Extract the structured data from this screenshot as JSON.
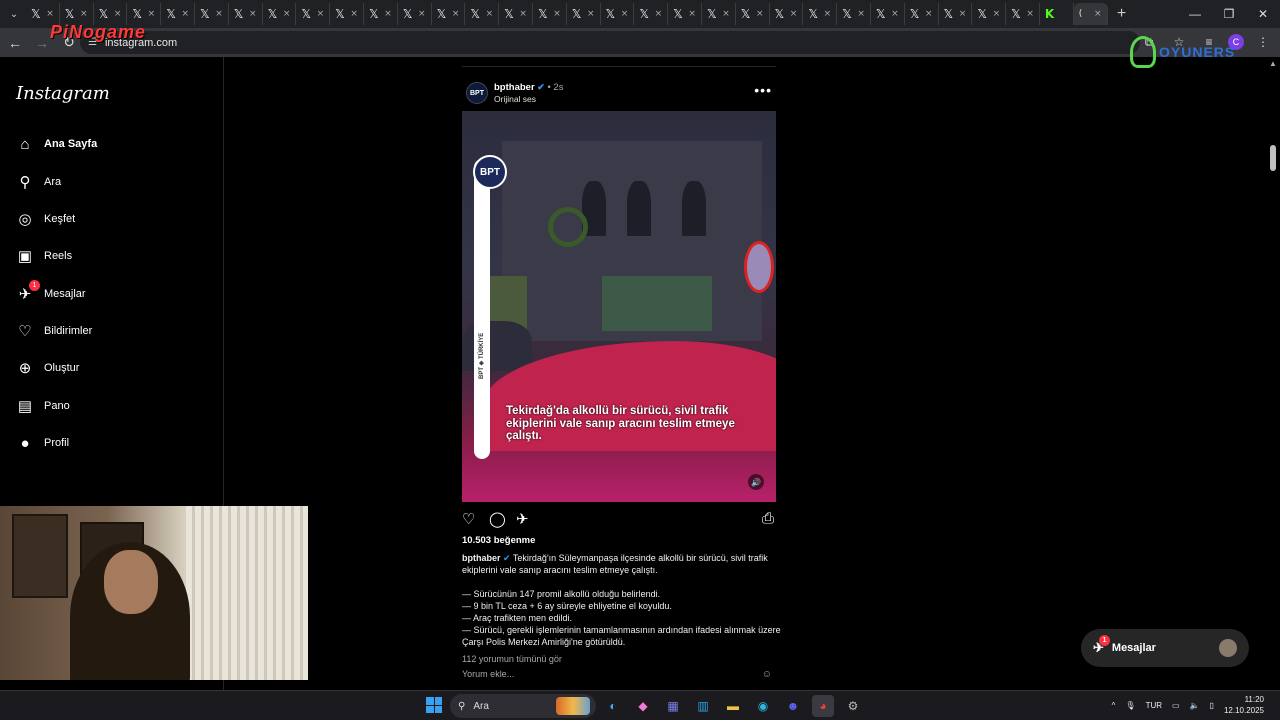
{
  "browser": {
    "tabs_count": 30,
    "tab_glyph": "𝕏",
    "tab_close": "×",
    "active_tab_close": "×",
    "new_tab": "+",
    "url": "instagram.com",
    "window_controls": [
      "—",
      "❐",
      "✕"
    ]
  },
  "overlays": {
    "left_logo": "PiNogame",
    "right_logo": "OYUNERS"
  },
  "sidebar": {
    "brand": "Instagram",
    "items": [
      {
        "label": "Ana Sayfa",
        "icon": "home-icon",
        "glyph": "⌂",
        "bold": true
      },
      {
        "label": "Ara",
        "icon": "search-icon",
        "glyph": "⚲"
      },
      {
        "label": "Keşfet",
        "icon": "compass-icon",
        "glyph": "◎"
      },
      {
        "label": "Reels",
        "icon": "reels-icon",
        "glyph": "▣"
      },
      {
        "label": "Mesajlar",
        "icon": "messenger-icon",
        "glyph": "✈",
        "badge": "1"
      },
      {
        "label": "Bildirimler",
        "icon": "heart-icon",
        "glyph": "♡"
      },
      {
        "label": "Oluştur",
        "icon": "plus-square-icon",
        "glyph": "⊕"
      },
      {
        "label": "Pano",
        "icon": "dashboard-icon",
        "glyph": "▤"
      },
      {
        "label": "Profil",
        "icon": "profile-avatar-icon",
        "glyph": "●"
      }
    ]
  },
  "post": {
    "username": "bpthaber",
    "verified_glyph": "✔",
    "time": "• 2s",
    "audio": "Orijinal ses",
    "avatar_text": "BPT",
    "more": "•••",
    "video": {
      "logo_text": "BPT",
      "vertical_text": "BPT  ◈  TÜRKİYE",
      "caption": "Tekirdağ'da alkollü bir sürücü, sivil trafik ekiplerini vale sanıp aracını teslim etmeye çalıştı."
    },
    "likes": "10.503 beğenme",
    "caption_username": "bpthaber",
    "caption_first": "Tekirdağ'ın Süleymanpaşa ilçesinde alkollü bir sürücü, sivil trafik ekiplerini vale sanıp aracını teslim etmeye çalıştı.",
    "caption_lines": [
      "— Sürücünün 147 promil alkollü olduğu belirlendi.",
      "— 9 bin TL ceza + 6 ay süreyle ehliyetine el koyuldu.",
      "— Araç trafikten men edildi.",
      "— Sürücü, gerekli işlemlerinin tamamlanmasının ardından ifadesi alınmak üzere Çarşı Polis Merkezi Amirliği'ne götürüldü."
    ],
    "comments_link": "112 yorumun tümünü gör",
    "comment_placeholder": "Yorum ekle..."
  },
  "messages_pill": {
    "label": "Mesajlar",
    "badge": "1"
  },
  "taskbar": {
    "search_label": "Ara",
    "language": "TUR",
    "time": "11:20",
    "date": "12.10.2025"
  },
  "colors": {
    "background": "#000000",
    "verified": "#3897f0",
    "badge": "#ff3040"
  }
}
